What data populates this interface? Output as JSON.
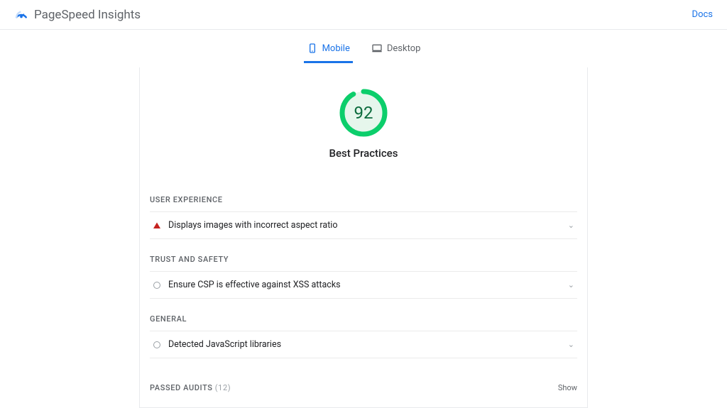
{
  "header": {
    "title": "PageSpeed Insights",
    "docs": "Docs"
  },
  "tabs": {
    "mobile": "Mobile",
    "desktop": "Desktop"
  },
  "score": {
    "value": "92",
    "label": "Best Practices",
    "percent": 92,
    "color": "#0cce6b",
    "bg": "#e6f6ec"
  },
  "sections": [
    {
      "heading": "USER EXPERIENCE",
      "status": "warn",
      "title": "Displays images with incorrect aspect ratio"
    },
    {
      "heading": "TRUST AND SAFETY",
      "status": "info",
      "title": "Ensure CSP is effective against XSS attacks"
    },
    {
      "heading": "GENERAL",
      "status": "info",
      "title": "Detected JavaScript libraries"
    }
  ],
  "passed": {
    "label": "PASSED AUDITS",
    "count": "(12)",
    "show": "Show"
  }
}
